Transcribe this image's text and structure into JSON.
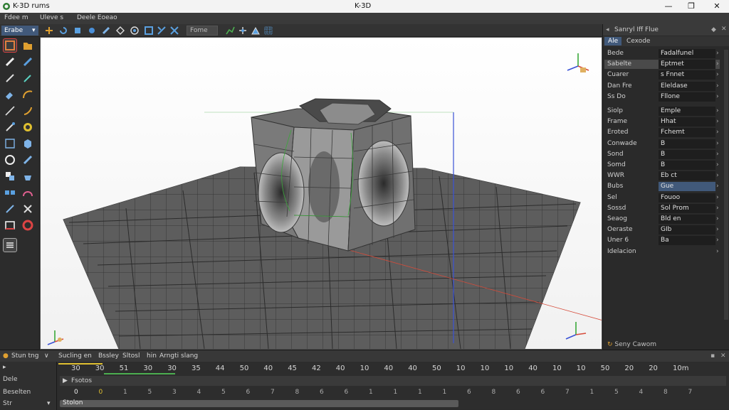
{
  "window": {
    "app_name": "K-3D rums",
    "title": "K-3D",
    "minimize": "—",
    "maximize": "❐",
    "close": "✕"
  },
  "menu": [
    "Fdee m",
    "Uleve s",
    "Deele Eoeao"
  ],
  "toolbar": {
    "mode": "Erabe",
    "mode_arrow": "▾",
    "field": "Fome"
  },
  "right_panel": {
    "title": "Sanryl  Iff  Flue",
    "tabs": [
      "Ale",
      "Cexode"
    ],
    "properties": [
      {
        "label": "Bede",
        "value": "Fadalfunel"
      },
      {
        "label": "Sabelte",
        "value": "Eptmet"
      },
      {
        "label": "Cuarer",
        "value": "s Fnnet"
      },
      {
        "label": "Dan Fre",
        "value": "Eleldase"
      },
      {
        "label": "Ss Do",
        "value": "Fllone"
      },
      {
        "label": "Siolp",
        "value": "Emple"
      },
      {
        "label": "Frame",
        "value": "Hhat"
      },
      {
        "label": "Eroted",
        "value": "Fchemt"
      },
      {
        "label": "Conwade",
        "value": "B"
      },
      {
        "label": "Sond",
        "value": "B"
      },
      {
        "label": "Somd",
        "value": "B"
      },
      {
        "label": "WWR",
        "value": "Eb ct"
      },
      {
        "label": "Bubs",
        "value": "Gue"
      },
      {
        "label": "Sel",
        "value": "Fouoo"
      },
      {
        "label": "Sossd",
        "value": "Sol Prom"
      },
      {
        "label": "Seaog",
        "value": "Bld en"
      },
      {
        "label": "Oeraste",
        "value": "GIb"
      },
      {
        "label": "Uner 6",
        "value": "Ba"
      },
      {
        "label": "Idelacion",
        "value": ""
      }
    ],
    "footer": "Seny Cawom"
  },
  "timeline": {
    "header": [
      "Stun tng",
      "Sucling en",
      "Bssley",
      "Sltosl",
      "hin",
      "Arngti slang"
    ],
    "left_rows": [
      "Dele",
      "Beselten",
      "Str"
    ],
    "ruler": [
      "30",
      "30",
      "51",
      "30",
      "30",
      "35",
      "44",
      "50",
      "40",
      "45",
      "42",
      "40",
      "10",
      "40",
      "40",
      "50",
      "10",
      "10",
      "10",
      "40",
      "10",
      "10",
      "50",
      "20",
      "20",
      "10m"
    ],
    "track1_label": "Fsotos",
    "track2": [
      "0",
      "0",
      "1",
      "5",
      "3",
      "4",
      "5",
      "6",
      "7",
      "8",
      "6",
      "6",
      "1",
      "1",
      "1",
      "1",
      "6",
      "8",
      "6",
      "6",
      "7",
      "1",
      "5",
      "4",
      "8",
      "7"
    ],
    "track3_label": "Stolon"
  },
  "colors": {
    "accent": "#41597a",
    "viewport_bg": "#f4f4f4",
    "mesh": "#5e5e5e",
    "axis_x": "#d64b3a",
    "axis_y": "#3aa83a",
    "axis_z": "#3a52d6"
  }
}
